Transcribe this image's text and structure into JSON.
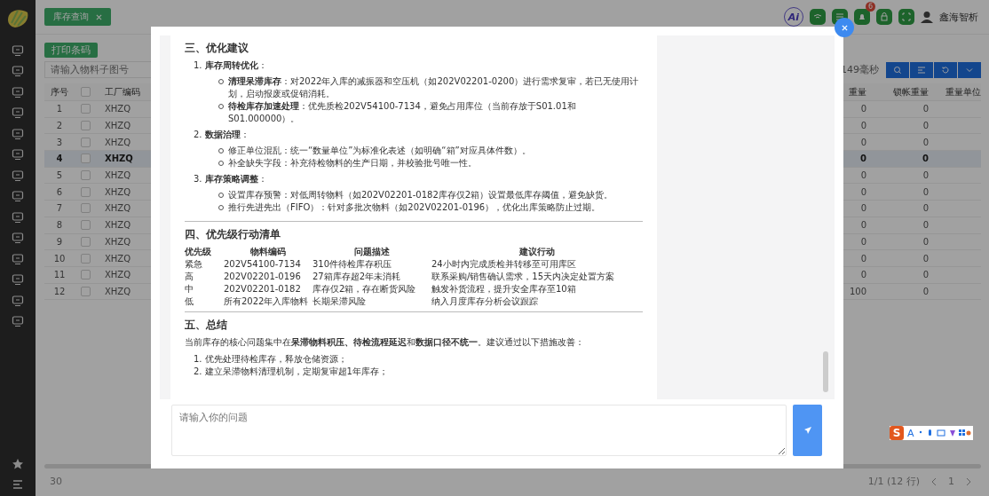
{
  "app": {
    "tab": {
      "label": "库存查询",
      "selected": true
    },
    "ai_label": "Ai",
    "notification_count": "6",
    "user": "鑫海智析"
  },
  "toolbar": {
    "print_button": "打印条码",
    "search": {
      "placeholder": "请输入物料子图号"
    },
    "timing": "149毫秒"
  },
  "table": {
    "all_checked": false,
    "columns": [
      "序号",
      "工厂编码",
      "重量",
      "锁帐重量",
      "重量单位"
    ],
    "rows": [
      {
        "index": "1",
        "factory": "XHZQ",
        "weight": "0",
        "locked_weight": "0",
        "checked": false,
        "selected": false
      },
      {
        "index": "2",
        "factory": "XHZQ",
        "weight": "0",
        "locked_weight": "0",
        "checked": false,
        "selected": false
      },
      {
        "index": "3",
        "factory": "XHZQ",
        "weight": "0",
        "locked_weight": "0",
        "checked": false,
        "selected": false
      },
      {
        "index": "4",
        "factory": "XHZQ",
        "weight": "0",
        "locked_weight": "0",
        "checked": false,
        "selected": true
      },
      {
        "index": "5",
        "factory": "XHZQ",
        "weight": "0",
        "locked_weight": "0",
        "checked": false,
        "selected": false
      },
      {
        "index": "6",
        "factory": "XHZQ",
        "weight": "0",
        "locked_weight": "0",
        "checked": false,
        "selected": false
      },
      {
        "index": "7",
        "factory": "XHZQ",
        "weight": "0",
        "locked_weight": "0",
        "checked": false,
        "selected": false
      },
      {
        "index": "8",
        "factory": "XHZQ",
        "weight": "0",
        "locked_weight": "0",
        "checked": false,
        "selected": false
      },
      {
        "index": "9",
        "factory": "XHZQ",
        "weight": "0",
        "locked_weight": "0",
        "checked": false,
        "selected": false
      },
      {
        "index": "10",
        "factory": "XHZQ",
        "weight": "0",
        "locked_weight": "0",
        "checked": false,
        "selected": false
      },
      {
        "index": "11",
        "factory": "XHZQ",
        "weight": "0",
        "locked_weight": "0",
        "checked": false,
        "selected": false
      },
      {
        "index": "12",
        "factory": "XHZQ",
        "weight": "100",
        "locked_weight": "0",
        "checked": false,
        "selected": false
      }
    ]
  },
  "pagination": {
    "page_size": "30",
    "summary": "1/1 (12 行)",
    "page": "1"
  },
  "dialog": {
    "report": {
      "sections": [
        {
          "kind": "suggestions",
          "heading": "三、优化建议",
          "groups": [
            {
              "number": "1.",
              "title": "**库存周转优化**：",
              "bullets": [
                "**清理呆滞库存**：对2022年入库的减振器和空压机（如202V02201-0200）进行需求复审，若已无使用计划，启动报废或促销消耗。",
                "**待检库存加速处理**：优先质检202V54100-7134，避免占用库位（当前存放于S01.01和S01.000000）。"
              ]
            },
            {
              "number": "2.",
              "title": "**数据治理**：",
              "bullets": [
                "修正单位混乱：统一“数量单位”为标准化表述（如明确“箱”对应具体件数）。",
                "补全缺失字段：补充待检物料的生产日期，并校验批号唯一性。"
              ]
            },
            {
              "number": "3.",
              "title": "**库存策略调整**：",
              "bullets": [
                "设置库存预警：对低周转物料（如202V02201-0182库存仅2箱）设置最低库存阈值，避免缺货。",
                "推行先进先出（FIFO）：针对多批次物料（如202V02201-0196），优化出库策略防止过期。"
              ]
            }
          ]
        },
        {
          "kind": "table",
          "heading": "四、优先级行动清单",
          "columns": [
            "优先级",
            "物料编码",
            "问题描述",
            "建议行动"
          ],
          "rows": [
            [
              "紧急",
              "202V54100-7134",
              "310件待检库存积压",
              "24小时内完成质检并转移至可用库区"
            ],
            [
              "高",
              "202V02201-0196",
              "27箱库存超2年未消耗",
              "联系采购/销售确认需求，15天内决定处置方案"
            ],
            [
              "中",
              "202V02201-0182",
              "库存仅2箱，存在断货风险",
              "触发补货流程，提升安全库存至10箱"
            ],
            [
              "低",
              "所有2022年入库物料",
              "长期呆滞风险",
              "纳入月度库存分析会议跟踪"
            ]
          ]
        },
        {
          "kind": "summary",
          "heading": "五、总结",
          "paragraph": "当前库存的核心问题集中在**呆滞物料积压、待检流程延迟**和**数据口径不统一**。建议通过以下措施改善：",
          "items": [
            {
              "number": "1.",
              "text": "优先处理待检库存，释放仓储资源；"
            },
            {
              "number": "2.",
              "text": "建立呆滞物料清理机制，定期复审超1年库存；"
            }
          ]
        }
      ]
    },
    "input": {
      "placeholder": "请输入你的问题"
    }
  },
  "ime_toolbar": {
    "logo_letter": "S",
    "letter": "A"
  }
}
